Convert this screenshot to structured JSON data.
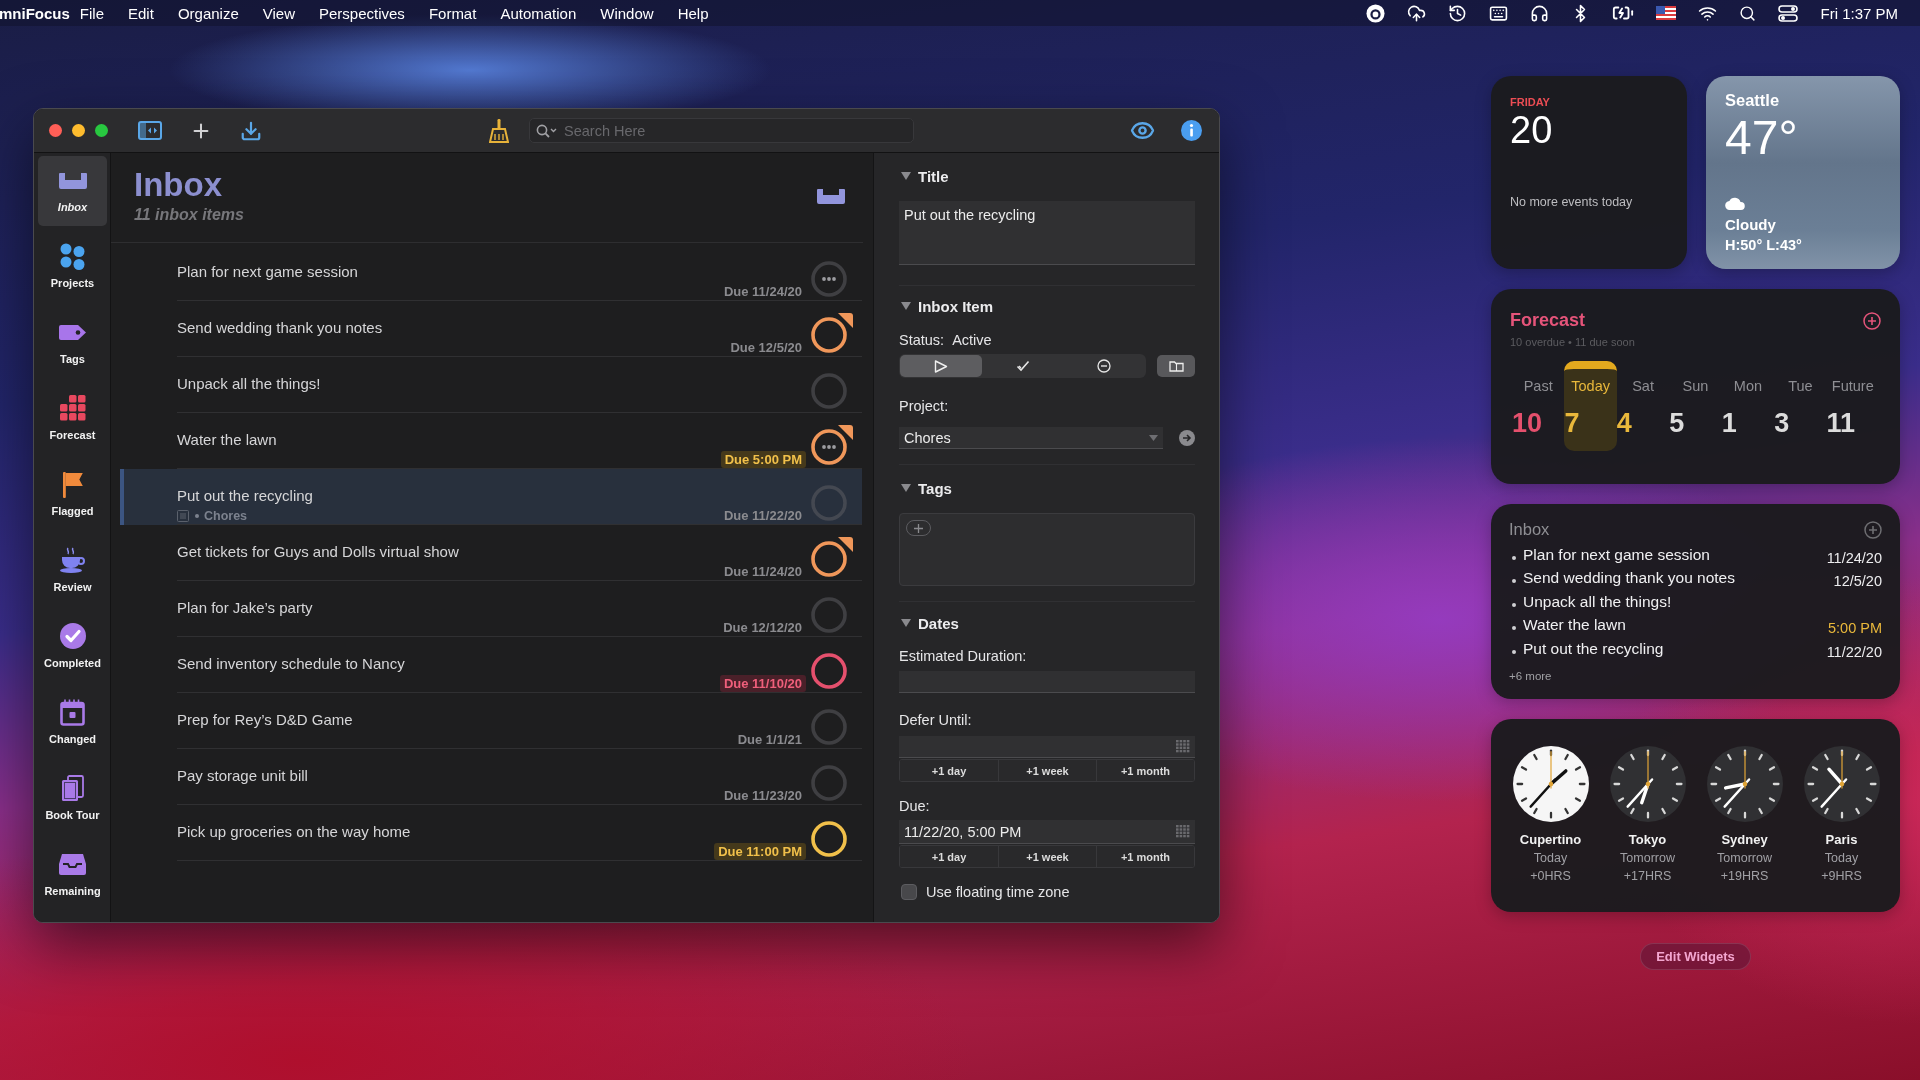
{
  "menu_bar": {
    "app": "mniFocus",
    "menus": [
      "File",
      "Edit",
      "Organize",
      "View",
      "Perspectives",
      "Format",
      "Automation",
      "Window",
      "Help"
    ],
    "clock": "Fri 1:37 PM"
  },
  "window": {
    "search": {
      "placeholder": "Search Here"
    },
    "sidebar": {
      "items": [
        {
          "label": "Inbox",
          "selected": true
        },
        {
          "label": "Projects",
          "selected": false
        },
        {
          "label": "Tags",
          "selected": false
        },
        {
          "label": "Forecast",
          "selected": false
        },
        {
          "label": "Flagged",
          "selected": false
        },
        {
          "label": "Review",
          "selected": false
        },
        {
          "label": "Completed",
          "selected": false
        },
        {
          "label": "Changed",
          "selected": false
        },
        {
          "label": "Book Tour",
          "selected": false
        },
        {
          "label": "Remaining",
          "selected": false
        }
      ]
    },
    "list": {
      "title": "Inbox",
      "subtitle": "11 inbox items",
      "rows": [
        {
          "title": "Plan for next game session",
          "due": "Due 11/24/20",
          "soon": false,
          "overdue": false,
          "flagged": false,
          "ellipsis": true,
          "selected": false
        },
        {
          "title": "Send wedding thank you notes",
          "due": "Due 12/5/20",
          "soon": false,
          "overdue": false,
          "flagged": true,
          "ellipsis": false,
          "selected": false
        },
        {
          "title": "Unpack all the things!",
          "soon": false,
          "overdue": false,
          "flagged": false,
          "ellipsis": false,
          "selected": false
        },
        {
          "title": "Water the lawn",
          "due": "Due 5:00 PM",
          "soon": true,
          "overdue": false,
          "flagged": true,
          "ellipsis": true,
          "selected": false
        },
        {
          "title": "Put out the recycling",
          "project": "Chores",
          "due": "Due 11/22/20",
          "soon": false,
          "overdue": false,
          "flagged": false,
          "ellipsis": false,
          "selected": true
        },
        {
          "title": "Get tickets for Guys and Dolls virtual show",
          "due": "Due 11/24/20",
          "soon": false,
          "overdue": false,
          "flagged": true,
          "ellipsis": false,
          "selected": false
        },
        {
          "title": "Plan for Jake’s party",
          "due": "Due 12/12/20",
          "soon": false,
          "overdue": false,
          "flagged": false,
          "ellipsis": false,
          "selected": false
        },
        {
          "title": "Send inventory schedule to Nancy",
          "due": "Due 11/10/20",
          "soon": false,
          "overdue": true,
          "flagged": false,
          "ellipsis": false,
          "selected": false
        },
        {
          "title": "Prep for Rey’s D&D Game",
          "due": "Due 1/1/21",
          "soon": false,
          "overdue": false,
          "flagged": false,
          "ellipsis": false,
          "selected": false
        },
        {
          "title": "Pay storage unit bill",
          "due": "Due 11/23/20",
          "soon": false,
          "overdue": false,
          "flagged": false,
          "ellipsis": false,
          "selected": false
        },
        {
          "title": "Pick up groceries on the way home",
          "due": "Due 11:00 PM",
          "soon": true,
          "overdue": false,
          "flagged": false,
          "ellipsis": false,
          "selected": false
        }
      ]
    },
    "inspector": {
      "title": {
        "heading": "Title",
        "expanded": true,
        "value": "Put out the recycling"
      },
      "item": {
        "heading": "Inbox Item",
        "expanded": true,
        "status_label": "Status:",
        "status": "Active",
        "status_buttons": [
          {
            "selected": true
          },
          {
            "selected": false
          },
          {
            "selected": false
          }
        ],
        "project_label": "Project:",
        "project": "Chores"
      },
      "tags": {
        "heading": "Tags",
        "expanded": true
      },
      "dates": {
        "heading": "Dates",
        "expanded": true,
        "duration_label": "Estimated Duration:",
        "defer_label": "Defer Until:",
        "defer_shortcuts": [
          "+1 day",
          "+1 week",
          "+1 month"
        ],
        "due_label": "Due:",
        "due": "11/22/20, 5:00 PM",
        "due_shortcuts": [
          "+1 day",
          "+1 week",
          "+1 month"
        ],
        "floating": {
          "label": "Use floating time zone",
          "checked": false
        }
      }
    }
  },
  "widgets": {
    "calendar": {
      "weekday": "FRIDAY",
      "day": "20",
      "note": "No more events today"
    },
    "weather": {
      "city": "Seattle",
      "temperature": "47°",
      "condition": "Cloudy",
      "range": "H:50° L:43°"
    },
    "forecast": {
      "title": "Forecast",
      "summary": "10 overdue • 11 due soon",
      "days": [
        {
          "label": "Past",
          "count": "10",
          "color": "#e5506d",
          "selected": false
        },
        {
          "label": "Today",
          "count": "7",
          "color": "#e9b83b",
          "selected": true
        },
        {
          "label": "Sat",
          "count": "4",
          "color": "#e9b83b",
          "selected": false
        },
        {
          "label": "Sun",
          "count": "5",
          "color": "#dcdcdc",
          "selected": false
        },
        {
          "label": "Mon",
          "count": "1",
          "color": "#dcdcdc",
          "selected": false
        },
        {
          "label": "Tue",
          "count": "3",
          "color": "#dcdcdc",
          "selected": false
        },
        {
          "label": "Future",
          "count": "11",
          "color": "#dcdcdc",
          "selected": false
        }
      ]
    },
    "inbox": {
      "title": "Inbox",
      "items": [
        {
          "title": "Plan for next game session",
          "due": "11/24/20",
          "color": "#ececee"
        },
        {
          "title": "Send wedding thank you notes",
          "due": "12/5/20",
          "color": "#ececee"
        },
        {
          "title": "Unpack all the things!"
        },
        {
          "title": "Water the lawn",
          "due": "5:00 PM",
          "color": "#e9b83b"
        },
        {
          "title": "Put out the recycling",
          "due": "11/22/20",
          "color": "#ececee"
        }
      ],
      "more": "+6 more"
    },
    "clocks": [
      {
        "city": "Cupertino",
        "day": "Today",
        "offset": "+0HRS",
        "dark_face": false
      },
      {
        "city": "Tokyo",
        "day": "Tomorrow",
        "offset": "+17HRS",
        "dark_face": true
      },
      {
        "city": "Sydney",
        "day": "Tomorrow",
        "offset": "+19HRS",
        "dark_face": true
      },
      {
        "city": "Paris",
        "day": "Today",
        "offset": "+9HRS",
        "dark_face": true
      }
    ],
    "edit_button": "Edit Widgets"
  }
}
